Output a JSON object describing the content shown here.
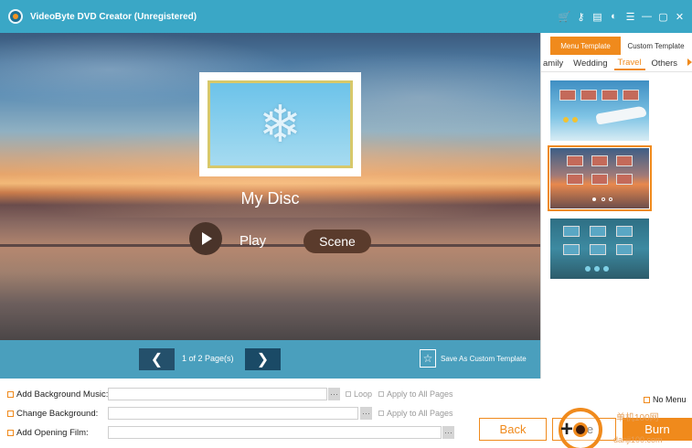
{
  "window": {
    "title": "VideoByte DVD Creator (Unregistered)"
  },
  "titlebar_icons": [
    "cart-icon",
    "key-icon",
    "file-icon",
    "feedback-icon",
    "menu-icon",
    "minimize-icon",
    "close-icon"
  ],
  "preview": {
    "disc_title": "My Disc",
    "play_label": "Play",
    "scene_label": "Scene"
  },
  "navbar": {
    "prev_glyph": "❮",
    "next_glyph": "❯",
    "page_indicator": "1 of 2 Page(s)",
    "save_template_label": "Save As Custom Template"
  },
  "templates": {
    "tabs": [
      "Menu Template",
      "Custom Template"
    ],
    "categories": [
      "amily",
      "Wedding",
      "Travel",
      "Others"
    ],
    "active_category": "Travel"
  },
  "bottom": {
    "add_bg_music": "Add Background Music:",
    "change_bg": "Change Background:",
    "add_opening_film": "Add Opening Film:",
    "browse_glyph": "···",
    "loop_label": "Loop",
    "apply_all_1": "Apply to All Pages",
    "apply_all_2": "Apply to All Pages",
    "no_menu_label": "No Menu",
    "back_label": "Back",
    "preview_label": "Pre",
    "burn_label": "Burn",
    "wm_text": "单机100网",
    "wm_text2": "danji100.com"
  },
  "colors": {
    "accent": "#f08a1c",
    "titlebar": "#3aa7c6",
    "navbar": "#4a9fbd"
  }
}
